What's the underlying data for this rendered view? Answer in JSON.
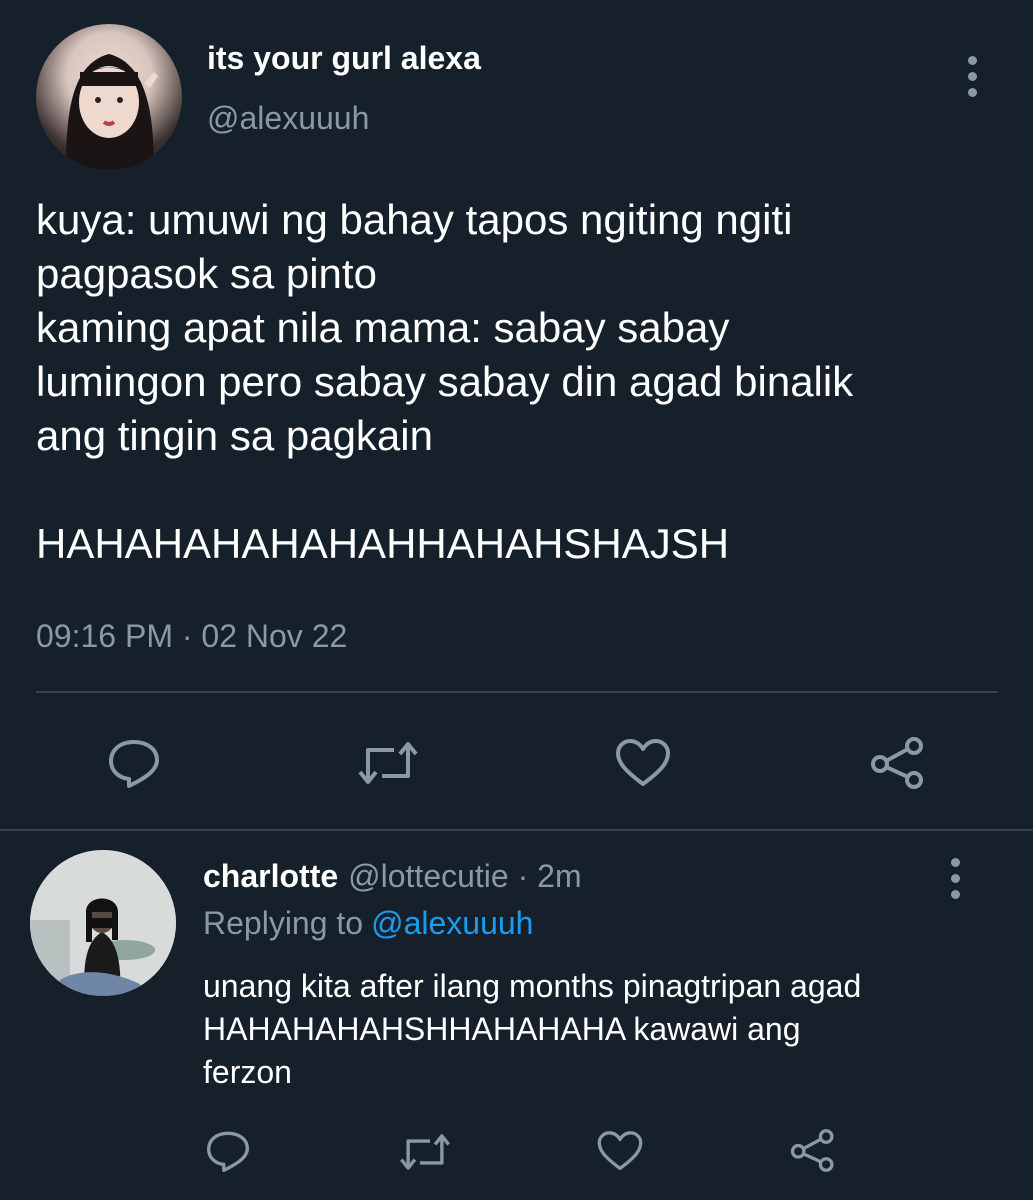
{
  "tweet": {
    "display_name": "its your gurl alexa",
    "handle": "@alexuuuh",
    "text": "kuya: umuwi ng bahay tapos ngiting ngiti\npagpasok sa pinto\nkaming apat nila mama: sabay sabay\nlumingon pero sabay sabay din agad binalik\nang tingin sa pagkain\n\nHAHAHAHAHAHAHHAHAHSHAJSH",
    "timestamp": "09:16 PM · 02 Nov 22",
    "actions": [
      "reply-icon",
      "retweet-icon",
      "like-icon",
      "share-icon"
    ]
  },
  "reply": {
    "display_name": "charlotte",
    "handle_time": "@lottecutie · 2m",
    "replying_label": "Replying to",
    "replying_to": "@alexuuuh",
    "text": "unang kita after ilang months pinagtripan agad\nHAHAHAHAHSHHAHAHAHA kawawi ang\nferzon",
    "actions": [
      "reply-icon",
      "retweet-icon",
      "like-icon",
      "share-icon"
    ]
  },
  "colors": {
    "background": "#15202b",
    "text": "#ffffff",
    "secondary": "#8b98a5",
    "link": "#1d9bf0",
    "divider": "#38444d"
  }
}
